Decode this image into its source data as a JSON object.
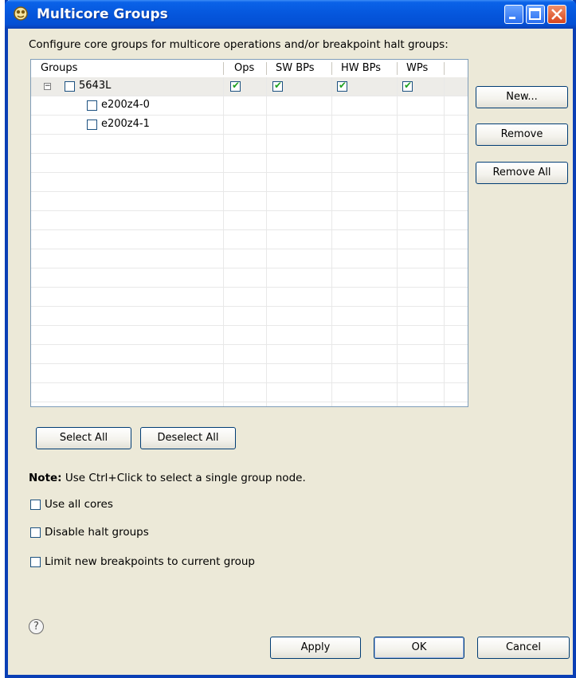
{
  "window": {
    "title": "Multicore Groups",
    "icon": "multicore-app-icon",
    "controls": [
      "minimize-icon",
      "maximize-icon",
      "close-icon"
    ]
  },
  "intro_text": "Configure core groups for multicore operations and/or breakpoint halt groups:",
  "table": {
    "columns": [
      "Groups",
      "Ops",
      "SW BPs",
      "HW BPs",
      "WPs"
    ],
    "rows": [
      {
        "label": "5643L",
        "expanded": true,
        "checked": false,
        "ops": true,
        "sw_bps": true,
        "hw_bps": true,
        "wps": true
      },
      {
        "label": "e200z4-0",
        "checked": false
      },
      {
        "label": "e200z4-1",
        "checked": false
      }
    ]
  },
  "side_buttons": {
    "new": "New...",
    "remove": "Remove",
    "remove_all": "Remove All"
  },
  "select_buttons": {
    "select_all": "Select All",
    "deselect_all": "Deselect All"
  },
  "note": {
    "bold": "Note:",
    "text": " Use Ctrl+Click to select a single group node."
  },
  "options": [
    {
      "label": "Use all cores",
      "checked": false
    },
    {
      "label": "Disable halt groups",
      "checked": false
    },
    {
      "label": "Limit new breakpoints to current group",
      "checked": false
    }
  ],
  "footer": {
    "help": "?",
    "apply": "Apply",
    "ok": "OK",
    "cancel": "Cancel"
  },
  "colors": {
    "titlebar": "#0556dc",
    "dialog_bg": "#ece9d8",
    "check": "#21a121"
  }
}
